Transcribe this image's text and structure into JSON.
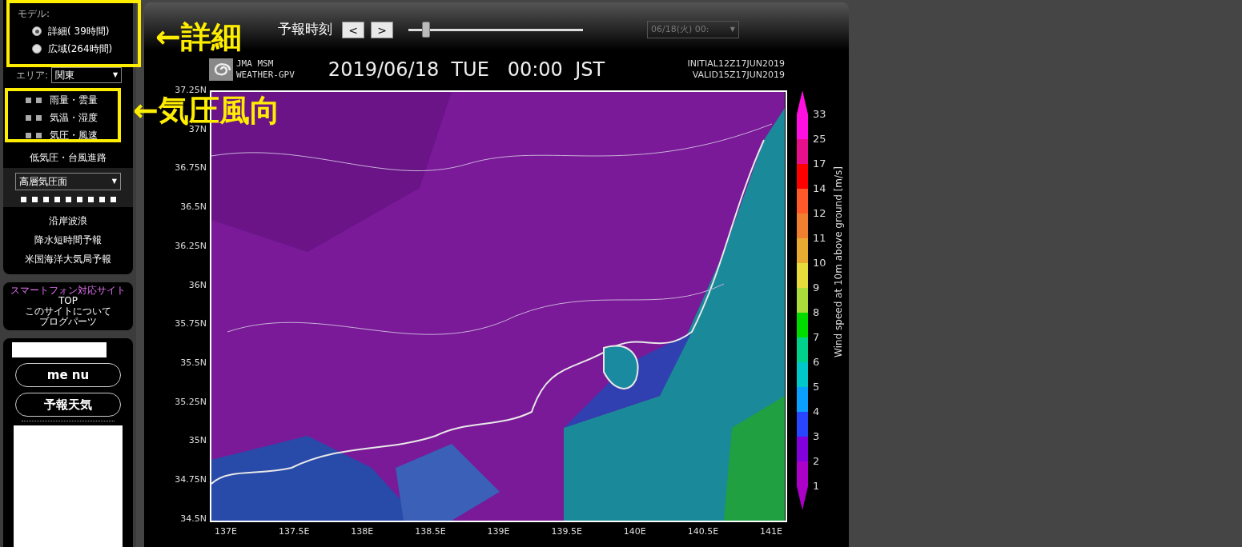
{
  "sidebar": {
    "model": {
      "label": "モデル:",
      "options": [
        {
          "label": "詳細(  39時間)",
          "selected": true
        },
        {
          "label": "広域(264時間)",
          "selected": false
        }
      ]
    },
    "area": {
      "label": "エリア:",
      "value": "関東",
      "caret": "▼"
    },
    "layers": [
      "雨量・雲量",
      "気温・湿度",
      "気圧・風速"
    ],
    "track_link": "低気圧・台風進路",
    "upper_select": {
      "value": "高層気圧面",
      "caret": "▼"
    },
    "links": [
      "沿岸波浪",
      "降水短時間予報",
      "米国海洋大気局予報"
    ],
    "smartphone": {
      "title": "スマートフォン対応サイト",
      "links": [
        "TOP",
        "このサイトについて",
        "ブログパーツ"
      ]
    },
    "menu_buttons": [
      "me nu",
      "予報天気"
    ]
  },
  "annotations": [
    "←詳細",
    "←気圧風向"
  ],
  "toolbar": {
    "label": "予報時刻",
    "prev": "<",
    "next": ">",
    "slider": {
      "level": 0.08
    },
    "time_select": {
      "value": "06/18(火) 00:",
      "caret": "▼",
      "disabled": true
    }
  },
  "map": {
    "logo_lines": [
      "JMA MSM",
      "WEATHER-GPV"
    ],
    "title": "2019/06/18  TUE   00:00  JST",
    "initial": "INITIAL12Z17JUN2019",
    "valid": "VALID15Z17JUN2019",
    "lat_labels": [
      "37.25N",
      "37N",
      "36.75N",
      "36.5N",
      "36.25N",
      "36N",
      "35.75N",
      "35.5N",
      "35.25N",
      "35N",
      "34.75N",
      "34.5N"
    ],
    "lon_labels": [
      "137E",
      "137.5E",
      "138E",
      "138.5E",
      "139E",
      "139.5E",
      "140E",
      "140.5E",
      "141E"
    ],
    "legend": {
      "title": "Wind speed at 10m above ground [m/s]",
      "labels": [
        "33",
        "25",
        "17",
        "14",
        "12",
        "11",
        "10",
        "9",
        "8",
        "7",
        "6",
        "5",
        "4",
        "3",
        "2",
        "1"
      ],
      "bands": [
        {
          "color": "#ff10e0"
        },
        {
          "color": "#e8108a"
        },
        {
          "color": "#ff0000"
        },
        {
          "color": "#ff5a28"
        },
        {
          "color": "#f08030"
        },
        {
          "color": "#e8aa30"
        },
        {
          "color": "#e6dc3a"
        },
        {
          "color": "#aadc3c"
        },
        {
          "color": "#00dc00"
        },
        {
          "color": "#00d28c"
        },
        {
          "color": "#00c8c8"
        },
        {
          "color": "#0aa0ff"
        },
        {
          "color": "#2846ff"
        },
        {
          "color": "#8200dc"
        },
        {
          "color": "#aa00c8"
        }
      ]
    }
  }
}
